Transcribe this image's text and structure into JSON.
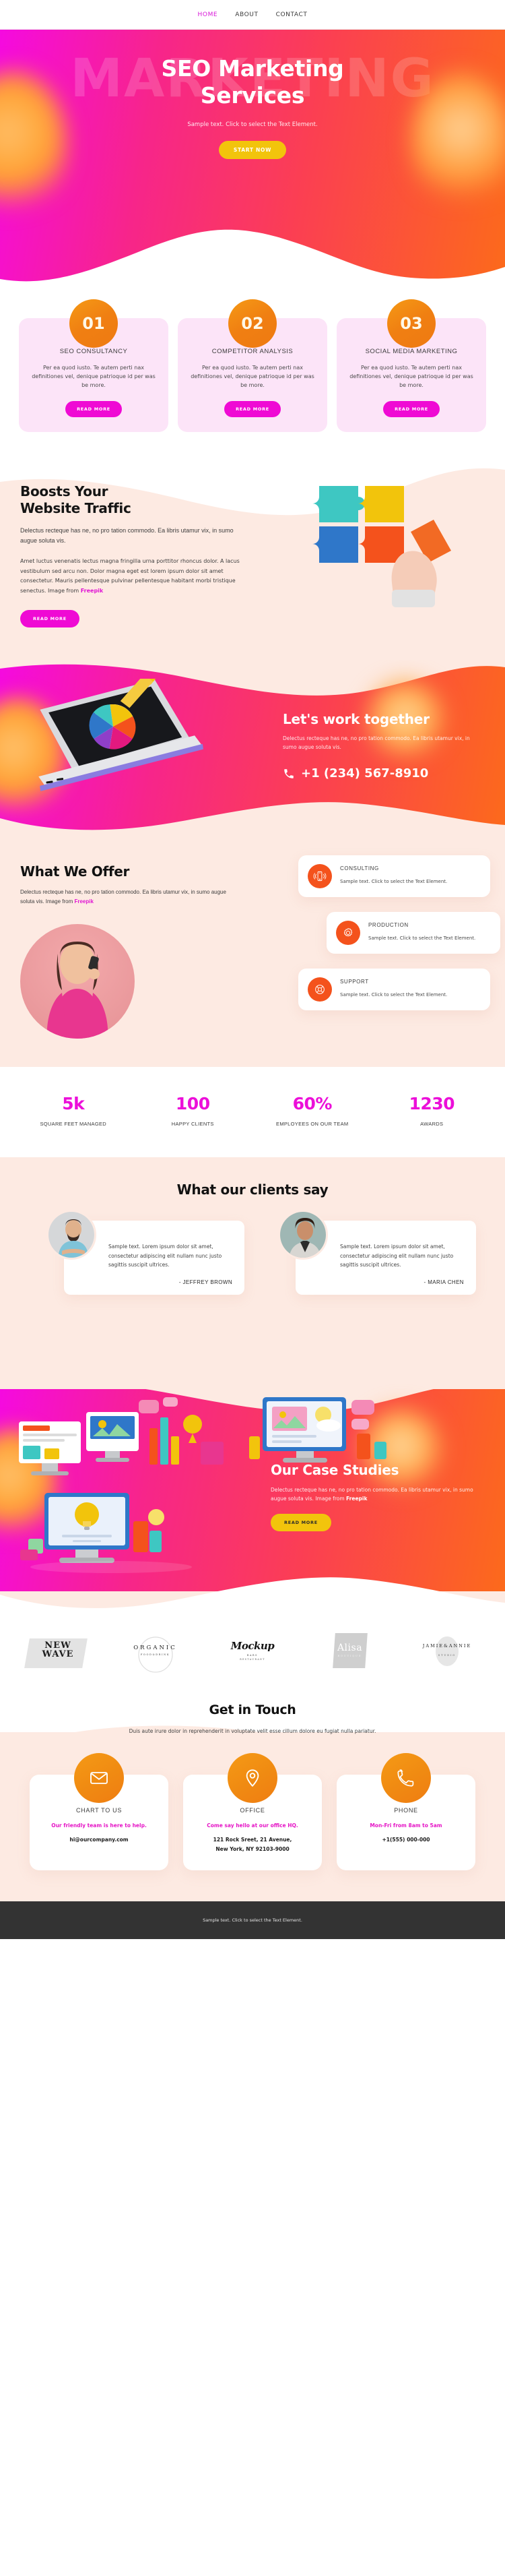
{
  "nav": {
    "items": [
      {
        "label": "HOME",
        "active": true
      },
      {
        "label": "ABOUT",
        "active": false
      },
      {
        "label": "CONTACT",
        "active": false
      }
    ]
  },
  "hero": {
    "ghost_text": "MARKETING",
    "title_line1": "SEO Marketing",
    "title_line2": "Services",
    "subtitle": "Sample text. Click to select the Text Element.",
    "cta": "START NOW"
  },
  "services": {
    "cards": [
      {
        "number": "01",
        "title": "SEO CONSULTANCY",
        "text": "Per ea quod iusto. Te autem perti nax definitiones vel, denique patrioque id per was be more.",
        "cta": "READ MORE"
      },
      {
        "number": "02",
        "title": "COMPETITOR ANALYSIS",
        "text": "Per ea quod iusto. Te autem perti nax definitiones vel, denique patrioque id per was be more.",
        "cta": "READ MORE"
      },
      {
        "number": "03",
        "title": "SOCIAL MEDIA MARKETING",
        "text": "Per ea quod iusto. Te autem perti nax definitiones vel, denique patrioque id per was be more.",
        "cta": "READ MORE"
      }
    ]
  },
  "boosts": {
    "title_line1": "Boosts Your",
    "title_line2": "Website Traffic",
    "lead": "Delectus recteque has ne, no pro tation commodo. Ea libris utamur vix, in sumo augue soluta vis.",
    "body": "Amet luctus venenatis lectus magna fringilla urna porttitor rhoncus dolor. A lacus vestibulum sed arcu non. Dolor magna eget est lorem ipsum dolor sit amet consectetur. Mauris pellentesque pulvinar pellentesque habitant morbi tristique senectus. Image from ",
    "credit": "Freepik",
    "cta": "READ MORE"
  },
  "work": {
    "title": "Let's work together",
    "text": "Delectus recteque has ne, no pro tation commodo. Ea libris utamur vix, in sumo augue soluta vis.",
    "phone": "+1 (234) 567-8910"
  },
  "offer": {
    "title": "What We Offer",
    "lead": "Delectus recteque has ne, no pro tation commodo. Ea libris utamur vix, in sumo augue soluta vis. Image from ",
    "credit": "Freepik",
    "cards": [
      {
        "icon": "mobile-vibrate-icon",
        "title": "CONSULTING",
        "text": "Sample text. Click to select the Text Element."
      },
      {
        "icon": "gear-icon",
        "title": "PRODUCTION",
        "text": "Sample text. Click to select the Text Element."
      },
      {
        "icon": "headset-support-icon",
        "title": "SUPPORT",
        "text": "Sample text. Click to select the Text Element."
      }
    ]
  },
  "stats": {
    "items": [
      {
        "value": "5k",
        "label": "SQUARE FEET MANAGED"
      },
      {
        "value": "100",
        "label": "HAPPY CLIENTS"
      },
      {
        "value": "60%",
        "label": "EMPLOYEES ON OUR TEAM"
      },
      {
        "value": "1230",
        "label": "AWARDS"
      }
    ]
  },
  "testimonials": {
    "title": "What our clients say",
    "items": [
      {
        "quote": "Sample text. Lorem ipsum dolor sit amet, consectetur adipiscing elit nullam nunc justo sagittis suscipit ultrices.",
        "name": "- JEFFREY BROWN"
      },
      {
        "quote": "Sample text. Lorem ipsum dolor sit amet, consectetur adipiscing elit nullam nunc justo sagittis suscipit ultrices.",
        "name": "- MARIA CHEN"
      }
    ]
  },
  "cases": {
    "title": "Our Case Studies",
    "text": "Delectus recteque has ne, no pro tation commodo. Ea libris utamur vix, in sumo augue soluta vis. Image from ",
    "credit": "Freepik",
    "cta": "READ MORE"
  },
  "logos": [
    {
      "name": "new-wave",
      "line1": "NEW",
      "line2": "WAVE"
    },
    {
      "name": "organic",
      "line1": "ORGANIC",
      "line2": "FOOD&DRINK"
    },
    {
      "name": "mockup",
      "line1": "Mockup",
      "line2": "BARS",
      "line3": "RESTAURANT"
    },
    {
      "name": "alisa",
      "line1": "Alisa",
      "line2": "BOUTIQUE"
    },
    {
      "name": "jamie-annie",
      "line1": "JAMIE&ANNIE",
      "line2": "STUDIO"
    }
  ],
  "touch": {
    "title": "Get in Touch",
    "subtitle": "Duis aute irure dolor in reprehenderit in voluptate velit esse cillum dolore eu fugiat nulla pariatur.",
    "cards": [
      {
        "icon": "envelope-icon",
        "title": "CHART TO US",
        "pink": "Our friendly team is here to help.",
        "dark1": "hi@ourcompany.com",
        "dark2": ""
      },
      {
        "icon": "map-pin-icon",
        "title": "OFFICE",
        "pink": "Come say hello at our office HQ.",
        "dark1": "121 Rock Sreet, 21 Avenue,",
        "dark2": "New York, NY 92103-9000"
      },
      {
        "icon": "phone-icon",
        "title": "PHONE",
        "pink": "Mon-Fri from 8am to 5am",
        "dark1": "+1(555) 000-000",
        "dark2": ""
      }
    ]
  },
  "footer": {
    "text": "Sample text. Click to select the Text Element."
  },
  "colors": {
    "magenta": "#ef0ad4",
    "orange": "#f4521c",
    "yellow": "#f2c40c",
    "cream": "#fdeae2",
    "card_pink": "#fce4f8"
  }
}
